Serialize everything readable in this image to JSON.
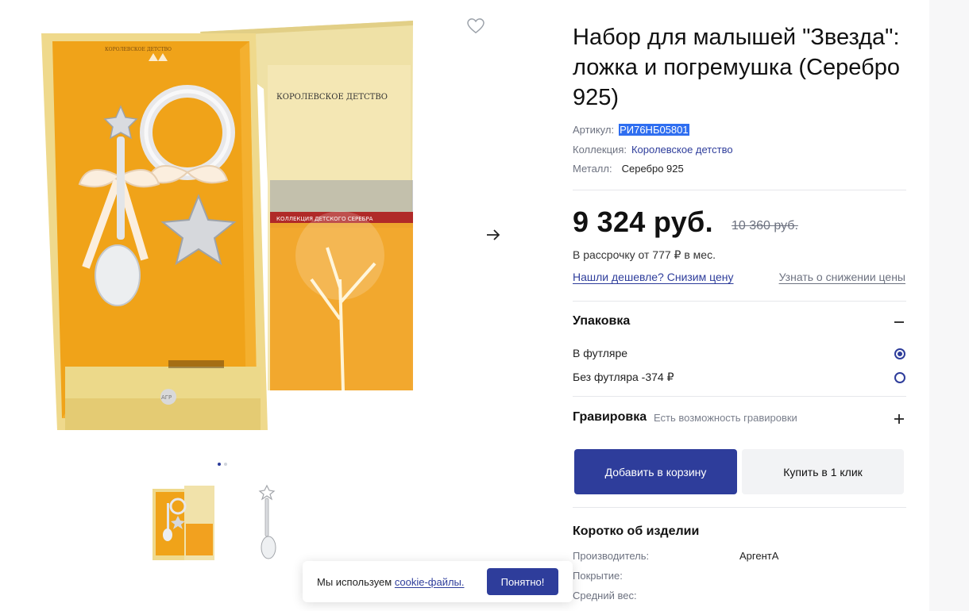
{
  "product": {
    "title": "Набор для малышей \"Звезда\": ложка и погремушка (Серебро 925)",
    "article_label": "Артикул:",
    "article_value": "РИ76НБ05801",
    "collection_label": "Коллекция:",
    "collection_value": "Королевское детство",
    "metal_label": "Металл:",
    "metal_value": "Серебро 925"
  },
  "pricing": {
    "price": "9 324 руб.",
    "old_price": "10 360 руб.",
    "installment": "В рассрочку от 777 ₽ в мес.",
    "cheaper_link": "Нашли дешевле? Снизим цену",
    "notify_link": "Узнать о снижении цены"
  },
  "packaging": {
    "title": "Упаковка",
    "toggle": "−",
    "options": [
      {
        "label": "В футляре",
        "checked": true
      },
      {
        "label": "Без футляра -374 ₽",
        "checked": false
      }
    ]
  },
  "engraving": {
    "title": "Гравировка",
    "subtitle": "Есть возможность гравировки",
    "toggle": "+"
  },
  "actions": {
    "add_to_cart": "Добавить в корзину",
    "buy_one_click": "Купить в 1 клик"
  },
  "brief": {
    "title": "Коротко об изделии",
    "specs": [
      {
        "label": "Производитель:",
        "value": "АргентА"
      },
      {
        "label": "Покрытие:",
        "value": ""
      },
      {
        "label": "Средний вес:",
        "value": ""
      }
    ]
  },
  "cookie": {
    "text": "Мы используем",
    "link": "cookie-файлы.",
    "button": "Понятно!"
  },
  "gallery": {
    "image_box_brand": "КОРОЛЕВСКОЕ ДЕТСТВО",
    "image_box_subtitle": "КОЛЛЕКЦИЯ ДЕТСКОГО СЕРЕБРА",
    "image_seal": "АГР",
    "image_small_caption": "КОРОЛЕВСКОЕ ДЕТСТВО"
  },
  "colors": {
    "accent": "#2e3d9b",
    "box_orange": "#f2a11f",
    "box_cream": "#efe1a6",
    "selection": "#2f6ef0"
  },
  "icons": {
    "favorite": "heart-icon",
    "next": "arrow-right-icon",
    "collapse": "minus-icon",
    "expand": "plus-icon"
  }
}
